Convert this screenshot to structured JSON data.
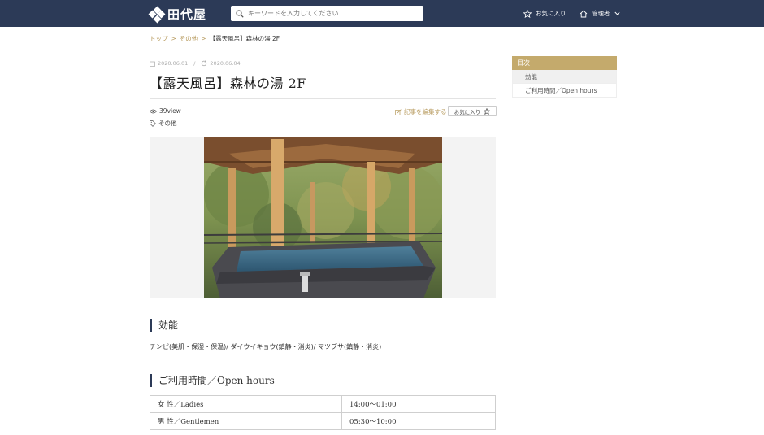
{
  "header": {
    "logo_text": "田代屋",
    "search_placeholder": "キーワードを入力してください",
    "favorites_label": "お気に入り",
    "admin_label": "管理者"
  },
  "breadcrumb": {
    "top": "トップ",
    "category": "その他",
    "current": "【露天風呂】森林の湯 2F"
  },
  "article": {
    "created_date": "2020.06.01",
    "updated_date": "2020.06.04",
    "title": "【露天風呂】森林の湯 2F",
    "views": "39view",
    "tag": "その他",
    "edit_label": "記事を編集する",
    "favorite_button": "お気に入り"
  },
  "sections": {
    "effect_heading": "効能",
    "effect_text": "チンピ(美肌・保湿・保温)/ ダイウイキョウ(鎮静・消炎)/ マツブサ(鎮静・消炎)",
    "hours_heading": "ご利用時間／Open hours",
    "hours": [
      {
        "label": "女 性／Ladies",
        "time": "14:00～01:00"
      },
      {
        "label": "男 性／Gentlemen",
        "time": "05:30～10:00"
      }
    ]
  },
  "toc": {
    "heading": "目次",
    "items": [
      "効能",
      "ご利用時間／Open hours"
    ]
  },
  "colors": {
    "header_bg": "#2c3a57",
    "accent_gold": "#b79a5d",
    "toc_head": "#c4aa6c"
  }
}
